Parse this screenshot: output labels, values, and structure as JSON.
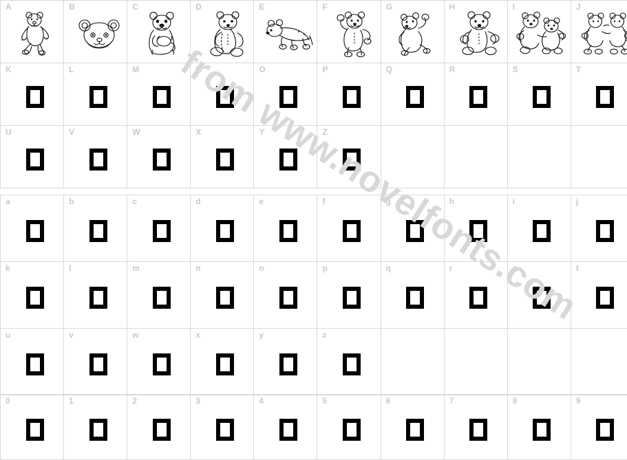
{
  "watermark": {
    "text": "from www.novelfonts.com",
    "color": "#d8d8d8"
  },
  "theme": {
    "grid_line_color": "#d9d9d9",
    "label_color": "#c9c9c9",
    "glyph_color": "#000000",
    "background": "#ffffff"
  },
  "sections": [
    {
      "name": "uppercase",
      "rows": [
        {
          "cells": [
            {
              "label": "A",
              "glyph": "bear-standing"
            },
            {
              "label": "B",
              "glyph": "bear-head"
            },
            {
              "label": "C",
              "glyph": "bear-with-pot"
            },
            {
              "label": "D",
              "glyph": "bear-sitting"
            },
            {
              "label": "E",
              "glyph": "bear-on-all-fours"
            },
            {
              "label": "F",
              "glyph": "bear-waving"
            },
            {
              "label": "G",
              "glyph": "bear-walking"
            },
            {
              "label": "H",
              "glyph": "bear-seated-arms-out"
            },
            {
              "label": "I",
              "glyph": "two-bears-hugging"
            },
            {
              "label": "J",
              "glyph": "two-bears-dancing"
            }
          ]
        },
        {
          "cells": [
            {
              "label": "K",
              "glyph": "missing-glyph"
            },
            {
              "label": "L",
              "glyph": "missing-glyph"
            },
            {
              "label": "M",
              "glyph": "missing-glyph"
            },
            {
              "label": "N",
              "glyph": "missing-glyph"
            },
            {
              "label": "O",
              "glyph": "missing-glyph"
            },
            {
              "label": "P",
              "glyph": "missing-glyph"
            },
            {
              "label": "Q",
              "glyph": "missing-glyph"
            },
            {
              "label": "R",
              "glyph": "missing-glyph"
            },
            {
              "label": "S",
              "glyph": "missing-glyph"
            },
            {
              "label": "T",
              "glyph": "missing-glyph"
            }
          ]
        },
        {
          "cells": [
            {
              "label": "U",
              "glyph": "missing-glyph"
            },
            {
              "label": "V",
              "glyph": "missing-glyph"
            },
            {
              "label": "W",
              "glyph": "missing-glyph"
            },
            {
              "label": "X",
              "glyph": "missing-glyph"
            },
            {
              "label": "Y",
              "glyph": "missing-glyph"
            },
            {
              "label": "Z",
              "glyph": "missing-glyph"
            },
            {
              "label": "",
              "glyph": "none"
            },
            {
              "label": "",
              "glyph": "none"
            },
            {
              "label": "",
              "glyph": "none"
            },
            {
              "label": "",
              "glyph": "none"
            }
          ]
        }
      ]
    },
    {
      "name": "lowercase",
      "rows": [
        {
          "cells": [
            {
              "label": "a",
              "glyph": "missing-glyph"
            },
            {
              "label": "b",
              "glyph": "missing-glyph"
            },
            {
              "label": "c",
              "glyph": "missing-glyph"
            },
            {
              "label": "d",
              "glyph": "missing-glyph"
            },
            {
              "label": "e",
              "glyph": "missing-glyph"
            },
            {
              "label": "f",
              "glyph": "missing-glyph"
            },
            {
              "label": "g",
              "glyph": "missing-glyph"
            },
            {
              "label": "h",
              "glyph": "missing-glyph"
            },
            {
              "label": "i",
              "glyph": "missing-glyph"
            },
            {
              "label": "j",
              "glyph": "missing-glyph"
            }
          ]
        },
        {
          "cells": [
            {
              "label": "k",
              "glyph": "missing-glyph"
            },
            {
              "label": "l",
              "glyph": "missing-glyph"
            },
            {
              "label": "m",
              "glyph": "missing-glyph"
            },
            {
              "label": "n",
              "glyph": "missing-glyph"
            },
            {
              "label": "o",
              "glyph": "missing-glyph"
            },
            {
              "label": "p",
              "glyph": "missing-glyph"
            },
            {
              "label": "q",
              "glyph": "missing-glyph"
            },
            {
              "label": "r",
              "glyph": "missing-glyph"
            },
            {
              "label": "s",
              "glyph": "missing-glyph"
            },
            {
              "label": "t",
              "glyph": "missing-glyph"
            }
          ]
        },
        {
          "cells": [
            {
              "label": "u",
              "glyph": "missing-glyph"
            },
            {
              "label": "v",
              "glyph": "missing-glyph"
            },
            {
              "label": "w",
              "glyph": "missing-glyph"
            },
            {
              "label": "x",
              "glyph": "missing-glyph"
            },
            {
              "label": "y",
              "glyph": "missing-glyph"
            },
            {
              "label": "z",
              "glyph": "missing-glyph"
            },
            {
              "label": "",
              "glyph": "none"
            },
            {
              "label": "",
              "glyph": "none"
            },
            {
              "label": "",
              "glyph": "none"
            },
            {
              "label": "",
              "glyph": "none"
            }
          ]
        }
      ]
    },
    {
      "name": "digits",
      "rows": [
        {
          "cells": [
            {
              "label": "0",
              "glyph": "missing-glyph"
            },
            {
              "label": "1",
              "glyph": "missing-glyph"
            },
            {
              "label": "2",
              "glyph": "missing-glyph"
            },
            {
              "label": "3",
              "glyph": "missing-glyph"
            },
            {
              "label": "4",
              "glyph": "missing-glyph"
            },
            {
              "label": "5",
              "glyph": "missing-glyph"
            },
            {
              "label": "6",
              "glyph": "missing-glyph"
            },
            {
              "label": "7",
              "glyph": "missing-glyph"
            },
            {
              "label": "8",
              "glyph": "missing-glyph"
            },
            {
              "label": "9",
              "glyph": "missing-glyph"
            }
          ]
        }
      ]
    }
  ]
}
